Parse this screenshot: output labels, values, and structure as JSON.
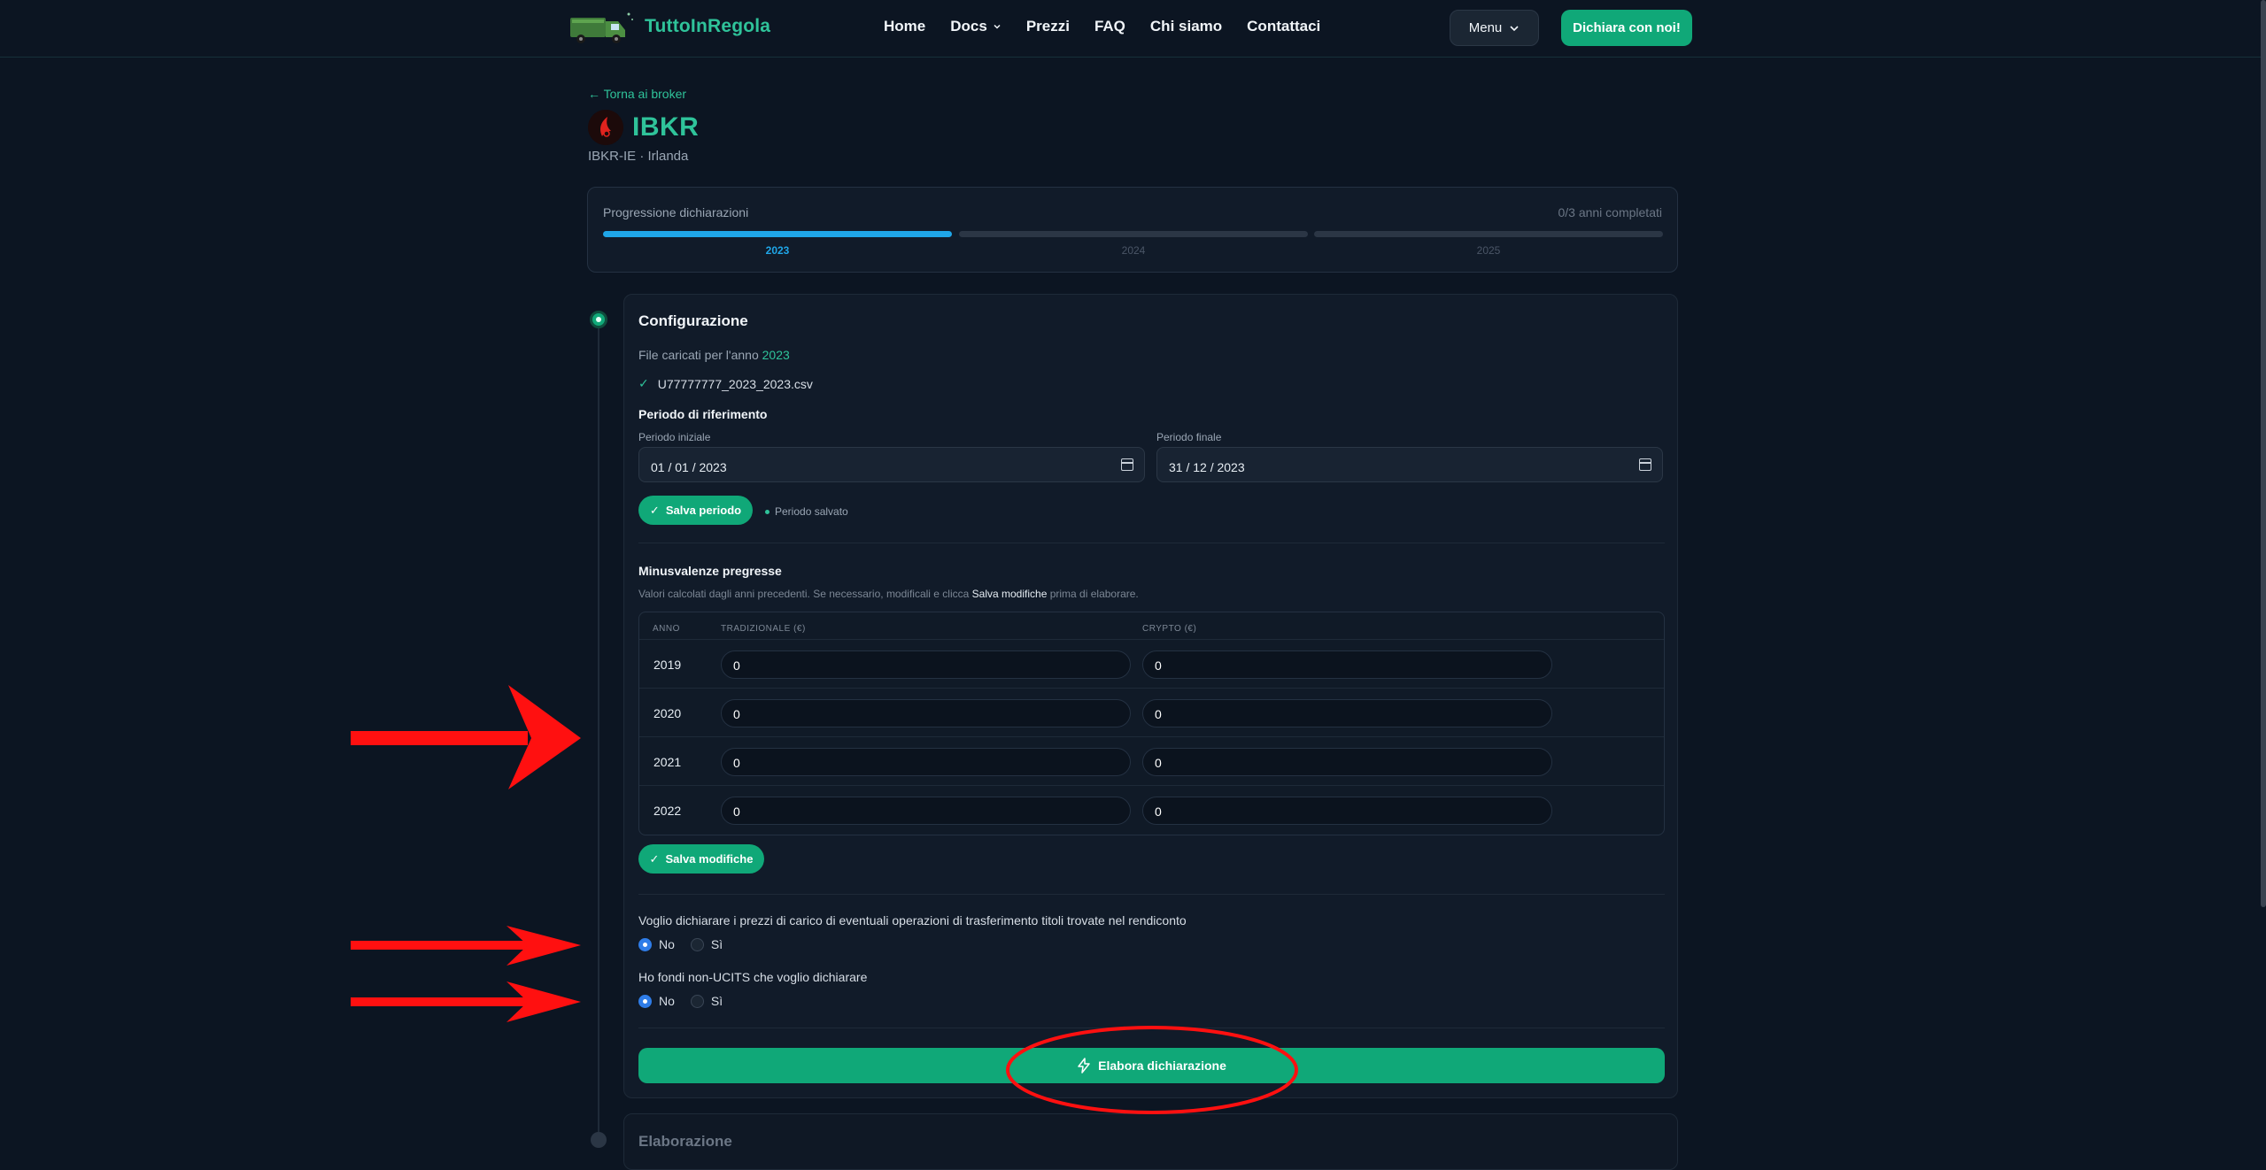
{
  "header": {
    "logo_text": "TuttoInRegola",
    "nav": [
      "Home",
      "Docs",
      "Prezzi",
      "FAQ",
      "Chi siamo",
      "Contattaci"
    ],
    "menu_label": "Menu",
    "cta_label": "Dichiara con noi!"
  },
  "back_link": "← Torna ai broker",
  "broker": {
    "name": "IBKR",
    "subtitle": "IBKR-IE · Irlanda"
  },
  "progress": {
    "title": "Progressione dichiarazioni",
    "count": "0/3 anni completati",
    "years": [
      "2023",
      "2024",
      "2025"
    ],
    "active_year_index": 0
  },
  "config": {
    "title": "Configurazione",
    "files_label": "File caricati per l'anno",
    "files_year": "2023",
    "file_name": "U77777777_2023_2023.csv",
    "period_title": "Periodo di riferimento",
    "start_label": "Periodo iniziale",
    "start_value": "01 / 01 / 2023",
    "end_label": "Periodo finale",
    "end_value": "31 / 12 / 2023",
    "save_period_label": "Salva periodo",
    "saved_note": "Periodo salvato",
    "minus_title": "Minusvalenze pregresse",
    "minus_desc_pre": "Valori calcolati dagli anni precedenti. Se necessario, modificali e clicca",
    "minus_desc_bold": "Salva modifiche",
    "minus_desc_post": "prima di elaborare.",
    "table_headers": {
      "year": "ANNO",
      "trad": "TRADIZIONALE (€)",
      "crypto": "CRYPTO (€)"
    },
    "rows": [
      {
        "year": "2019",
        "trad": "0",
        "crypto": "0"
      },
      {
        "year": "2020",
        "trad": "0",
        "crypto": "0"
      },
      {
        "year": "2021",
        "trad": "0",
        "crypto": "0"
      },
      {
        "year": "2022",
        "trad": "0",
        "crypto": "0"
      }
    ],
    "save_changes_label": "Salva modifiche",
    "q1": "Voglio dichiarare i prezzi di carico di eventuali operazioni di trasferimento titoli trovate nel rendiconto",
    "q2": "Ho fondi non-UCITS che voglio dichiarare",
    "option_no": "No",
    "option_yes": "Sì",
    "q1_selected": "No",
    "q2_selected": "No",
    "elabora_label": "Elabora dichiarazione"
  },
  "elaborazione_title": "Elaborazione",
  "colors": {
    "accent": "#10a878",
    "progress_active": "#1fa6e8",
    "annotation": "#ff1010"
  }
}
